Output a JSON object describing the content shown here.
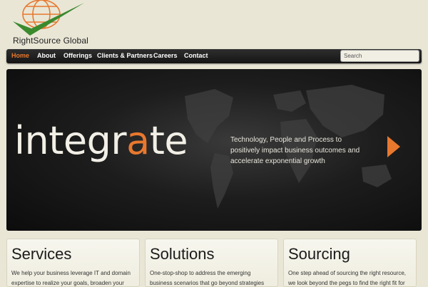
{
  "logo": {
    "text": "RightSource Global"
  },
  "nav": {
    "items": [
      {
        "label": "Home",
        "active": true
      },
      {
        "label": "About",
        "active": false
      },
      {
        "label": "Offerings",
        "active": false
      },
      {
        "label": "Clients & Partners",
        "active": false
      },
      {
        "label": "Careers",
        "active": false
      },
      {
        "label": "Contact",
        "active": false
      }
    ],
    "search_placeholder": "Search"
  },
  "hero": {
    "word_before": "integr",
    "word_accent": "a",
    "word_after": "te",
    "tagline": "Technology, People and Process to positively impact business outcomes and accelerate exponential growth",
    "arrow_icon": "right-arrow-icon"
  },
  "cards": [
    {
      "title": "Services",
      "text": "We help your business leverage IT and domain expertise to realize your goals, broaden your"
    },
    {
      "title": "Solutions",
      "text": "One-stop-shop to address the emerging business scenarios that go beyond strategies and technical"
    },
    {
      "title": "Sourcing",
      "text": "One step ahead of sourcing the right resource, we look beyond the pegs to find the right fit for your"
    }
  ],
  "colors": {
    "accent": "#e8782e",
    "logo_green": "#3b8a2e",
    "background": "#e9e6d6",
    "nav_bg": "#1f1f1f"
  }
}
